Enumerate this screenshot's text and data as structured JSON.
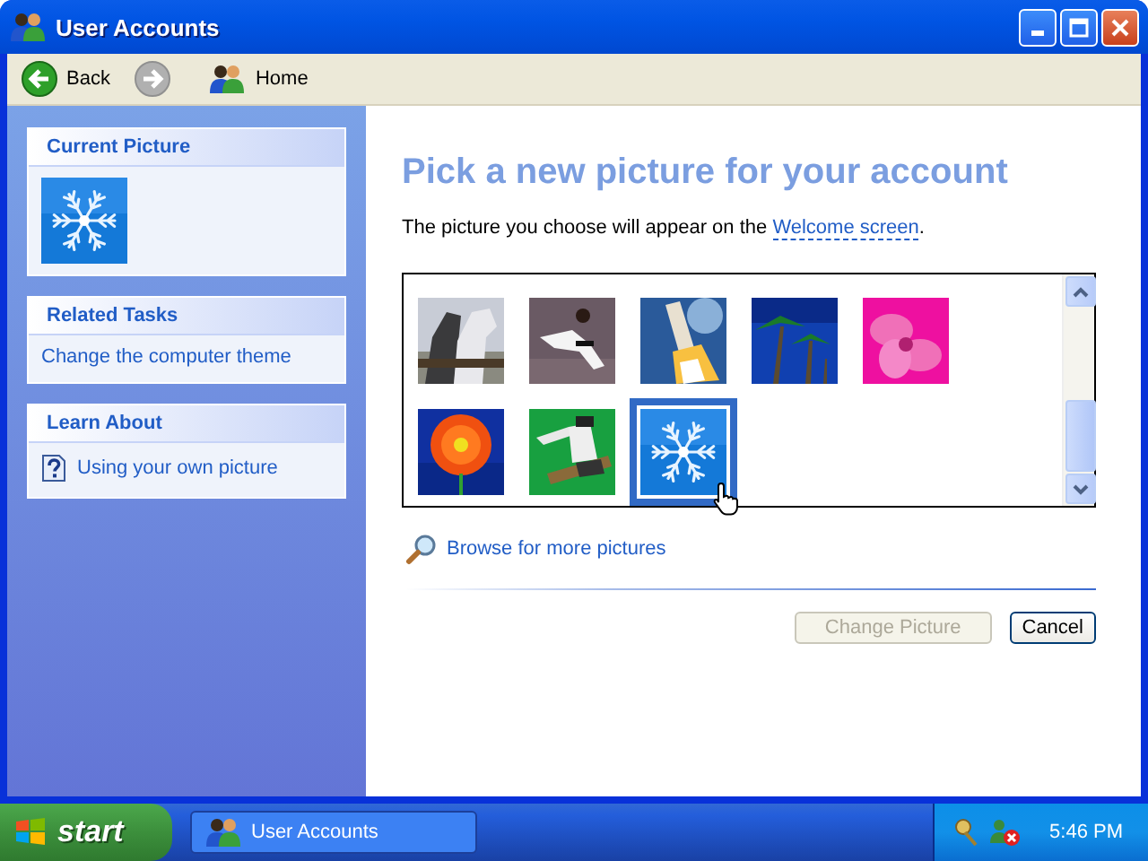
{
  "window": {
    "title": "User Accounts"
  },
  "toolbar": [
    {
      "kind": "back",
      "label": "Back",
      "disabled": false
    },
    {
      "kind": "forward",
      "disabled": true
    },
    {
      "kind": "home",
      "label": "Home",
      "disabled": false
    }
  ],
  "sidebar": [
    {
      "kind": "current-picture",
      "title": "Current Picture"
    },
    {
      "kind": "links",
      "title": "Related Tasks",
      "items": [
        {
          "label": "Change the computer theme"
        }
      ]
    },
    {
      "kind": "help",
      "title": "Learn About",
      "items": [
        {
          "label": "Using your own picture"
        }
      ]
    }
  ],
  "main": {
    "heading": "Pick a new picture for your account",
    "description": "The picture you choose will appear on the",
    "link": "Welcome screen",
    "description_end": ".",
    "pictures": [
      {
        "kind": "picture",
        "selected": false
      },
      {
        "kind": "picture",
        "selected": false
      },
      {
        "kind": "picture",
        "selected": false
      },
      {
        "kind": "picture",
        "selected": false
      },
      {
        "kind": "picture",
        "selected": false
      },
      {
        "kind": "picture",
        "selected": false
      },
      {
        "kind": "picture",
        "selected": false
      },
      {
        "kind": "picture",
        "selected": true
      }
    ],
    "browse": "Browse for more pictures",
    "buttons": [
      {
        "label": "Change Picture",
        "disabled": true
      },
      {
        "label": "Cancel",
        "disabled": false
      }
    ]
  },
  "taskbar": {
    "start": "start",
    "tasks": [
      {
        "label": "User Accounts",
        "selected": false
      }
    ],
    "clock": "5:46 PM"
  }
}
